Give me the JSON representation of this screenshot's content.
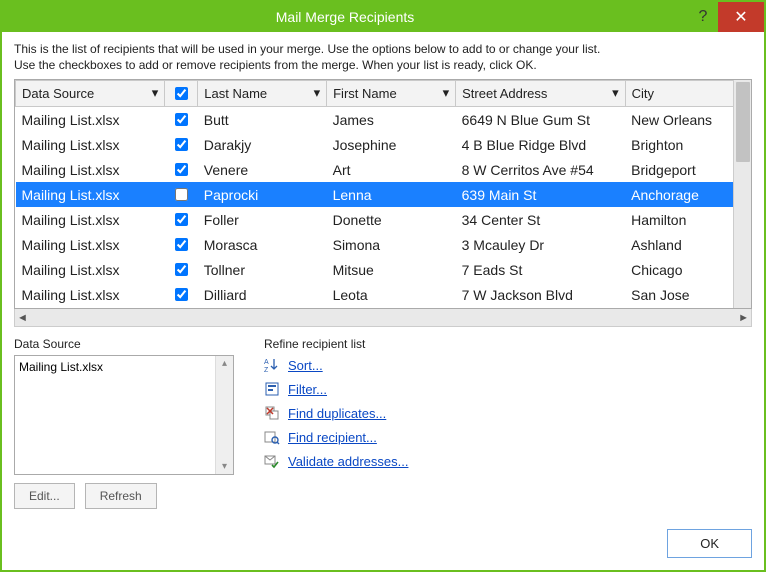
{
  "window": {
    "title": "Mail Merge Recipients"
  },
  "instructions": {
    "line1": "This is the list of recipients that will be used in your merge.  Use the options below to add to or change your list.",
    "line2": "Use the checkboxes to add or remove recipients from the merge.  When your list is ready, click OK."
  },
  "headers": {
    "data_source": "Data Source",
    "last_name": "Last Name",
    "first_name": "First Name",
    "street_address": "Street Address",
    "city": "City"
  },
  "rows": [
    {
      "source": "Mailing List.xlsx",
      "checked": true,
      "last": "Butt",
      "first": "James",
      "street": "6649 N Blue Gum St",
      "city": "New Orleans",
      "selected": false
    },
    {
      "source": "Mailing List.xlsx",
      "checked": true,
      "last": "Darakjy",
      "first": "Josephine",
      "street": "4 B Blue Ridge Blvd",
      "city": "Brighton",
      "selected": false
    },
    {
      "source": "Mailing List.xlsx",
      "checked": true,
      "last": "Venere",
      "first": "Art",
      "street": "8 W Cerritos Ave #54",
      "city": "Bridgeport",
      "selected": false
    },
    {
      "source": "Mailing List.xlsx",
      "checked": false,
      "last": "Paprocki",
      "first": "Lenna",
      "street": "639 Main St",
      "city": "Anchorage",
      "selected": true
    },
    {
      "source": "Mailing List.xlsx",
      "checked": true,
      "last": "Foller",
      "first": "Donette",
      "street": "34 Center St",
      "city": "Hamilton",
      "selected": false
    },
    {
      "source": "Mailing List.xlsx",
      "checked": true,
      "last": "Morasca",
      "first": "Simona",
      "street": "3 Mcauley Dr",
      "city": "Ashland",
      "selected": false
    },
    {
      "source": "Mailing List.xlsx",
      "checked": true,
      "last": "Tollner",
      "first": "Mitsue",
      "street": "7 Eads St",
      "city": "Chicago",
      "selected": false
    },
    {
      "source": "Mailing List.xlsx",
      "checked": true,
      "last": "Dilliard",
      "first": "Leota",
      "street": "7 W Jackson Blvd",
      "city": "San Jose",
      "selected": false
    }
  ],
  "data_sources": {
    "label": "Data Source",
    "items": [
      "Mailing List.xlsx"
    ],
    "edit_label": "Edit...",
    "refresh_label": "Refresh"
  },
  "refine": {
    "label": "Refine recipient list",
    "sort": "Sort...",
    "filter": "Filter...",
    "find_duplicates": "Find duplicates...",
    "find_recipient": "Find recipient...",
    "validate": "Validate addresses..."
  },
  "buttons": {
    "ok": "OK"
  }
}
